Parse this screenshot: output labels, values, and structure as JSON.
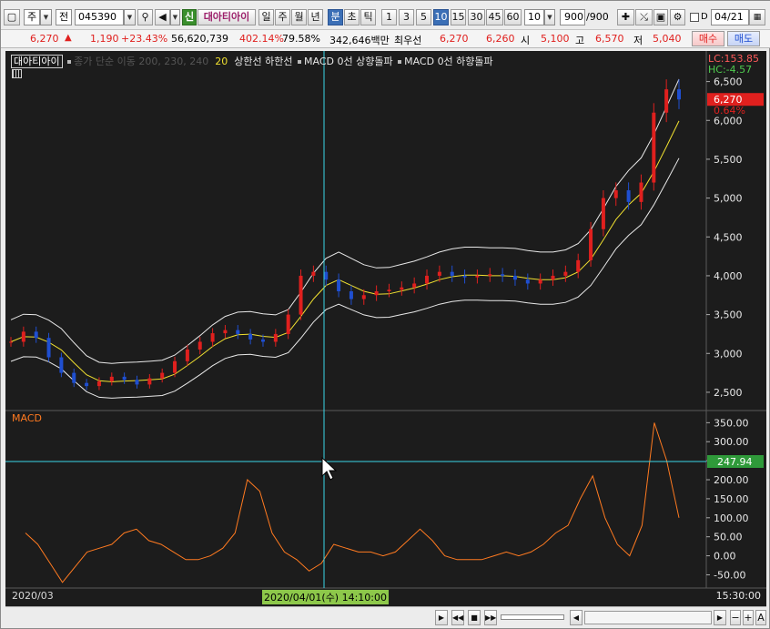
{
  "toolbar": {
    "market_select": "주",
    "market_type": "전",
    "code": "045390",
    "new_tag": "신",
    "stock_name": "대아티아이",
    "periods": [
      "일",
      "주",
      "월",
      "년",
      "분",
      "초",
      "틱"
    ],
    "active_period": "분",
    "intervals": [
      "1",
      "3",
      "5",
      "10",
      "15",
      "30",
      "45",
      "60"
    ],
    "active_interval": "10",
    "interval_value": "10",
    "count_value": "900",
    "count_total": "/900",
    "date_value": "04/21",
    "d_label": "D"
  },
  "quote": {
    "price": "6,270",
    "change": "1,190",
    "change_pct": "+23.43%",
    "volume": "56,620,739",
    "volume_ratio": "402.14%",
    "turnover": "79.58%",
    "amount": "342,646백만",
    "best_ask_label": "최우선",
    "best_ask": "6,270",
    "best_bid": "6,260",
    "open_label": "시",
    "open": "5,100",
    "high_label": "고",
    "high": "6,570",
    "low_label": "저",
    "low": "5,040",
    "buy_label": "매수",
    "sell_label": "매도"
  },
  "legend": {
    "stock": "대아티아이",
    "ma": "종가 단순 이동 200, 230, 240",
    "period": "20",
    "band": "상한선 하한선",
    "macd_up": "MACD 0선 상향돌파",
    "macd_down": "MACD 0선 하향돌파"
  },
  "price_axis": {
    "lc": "LC:153.85",
    "hc": "HC:-4.57",
    "current": "6,270",
    "current_pct": "0.64%",
    "ticks": [
      "6,500",
      "6,000",
      "5,500",
      "5,000",
      "4,500",
      "4,000",
      "3,500",
      "3,000",
      "2,500"
    ]
  },
  "macd_panel": {
    "title": "MACD",
    "current": "247.94",
    "ticks": [
      "350.00",
      "300.00",
      "250.00",
      "200.00",
      "150.00",
      "100.00",
      "50.00",
      "0.00",
      "-50.00"
    ]
  },
  "time_axis": {
    "left": "2020/03",
    "cursor": "2020/04/01(수) 14:10:00",
    "right": "15:30:00"
  },
  "colors": {
    "bg": "#1c1c1c",
    "up": "#e0201e",
    "down": "#1f4fd1",
    "macd": "#ff7a20",
    "ma20": "#f0e030",
    "crosshair": "#3ad6e8"
  },
  "chart_data": {
    "type": "line",
    "price_series_close": [
      3150,
      3280,
      3200,
      2950,
      2750,
      2620,
      2580,
      2640,
      2700,
      2660,
      2600,
      2680,
      2750,
      2900,
      3050,
      3150,
      3260,
      3300,
      3250,
      3180,
      3150,
      3250,
      3500,
      4000,
      4050,
      3950,
      3800,
      3700,
      3750,
      3800,
      3820,
      3850,
      3900,
      4000,
      4050,
      4000,
      3980,
      4000,
      4020,
      4000,
      3950,
      3900,
      3950,
      4000,
      4050,
      4200,
      4600,
      5000,
      5100,
      4950,
      5200,
      6100,
      6400,
      6270
    ],
    "macd_series": [
      60,
      30,
      -20,
      -70,
      -30,
      10,
      20,
      30,
      60,
      70,
      40,
      30,
      10,
      -10,
      -10,
      0,
      20,
      60,
      200,
      170,
      60,
      10,
      -10,
      -40,
      -20,
      30,
      20,
      10,
      10,
      0,
      10,
      40,
      70,
      40,
      0,
      -10,
      -10,
      -10,
      0,
      10,
      0,
      10,
      30,
      60,
      80,
      150,
      210,
      100,
      30,
      0,
      80,
      350,
      250,
      100
    ],
    "macd_ylim": [
      -80,
      370
    ],
    "price_ylim": [
      2300,
      6800
    ]
  }
}
